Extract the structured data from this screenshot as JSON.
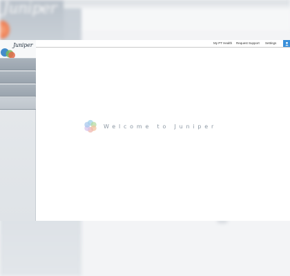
{
  "backdrop": {
    "logo_text": "Juniper"
  },
  "brand": {
    "logo_text": "Juniper"
  },
  "sidebar": {
    "item_count": 4
  },
  "topbar": {
    "links": {
      "my_health": "My PT Health",
      "request_support": "Request Support",
      "settings": "Settings"
    },
    "user_icon": "user-icon"
  },
  "main": {
    "welcome": "Welcome to Juniper"
  },
  "colors": {
    "accent_blue": "#3a8fd9",
    "nav_item": "#a3adb7",
    "welcome_text": "#8b97a3"
  }
}
